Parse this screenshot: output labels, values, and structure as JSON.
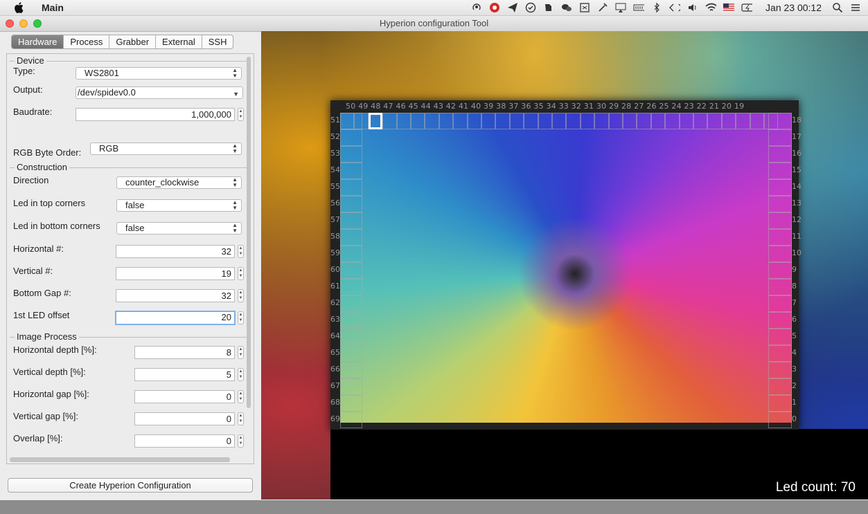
{
  "menubar": {
    "app_name": "Main",
    "clock": "Jan 23  00:12",
    "status_icons": [
      "podcast-icon",
      "red-dot-icon",
      "send-icon",
      "checkmark-icon",
      "evernote-icon",
      "wechat-icon",
      "dropbox-icon",
      "tools-icon",
      "airplay-icon",
      "battery-meter-icon",
      "bluetooth-icon",
      "code-icon",
      "volume-icon",
      "wifi-icon",
      "flag-us-icon",
      "battery-icon",
      "search-icon",
      "menu-icon"
    ]
  },
  "window": {
    "title": "Hyperion configuration Tool"
  },
  "tabs": [
    "Hardware",
    "Process",
    "Grabber",
    "External",
    "SSH"
  ],
  "active_tab": "Hardware",
  "device": {
    "group_label": "Device",
    "type_label": "Type:",
    "type_value": "WS2801",
    "output_label": "Output:",
    "output_value": "/dev/spidev0.0",
    "baudrate_label": "Baudrate:",
    "baudrate_value": "1,000,000",
    "rgb_label": "RGB Byte Order:",
    "rgb_value": "RGB"
  },
  "construction": {
    "group_label": "Construction",
    "direction_label": "Direction",
    "direction_value": "counter_clockwise",
    "top_corners_label": "Led in top corners",
    "top_corners_value": "false",
    "bottom_corners_label": "Led in bottom corners",
    "bottom_corners_value": "false",
    "horizontal_label": "Horizontal #:",
    "horizontal_value": "32",
    "vertical_label": "Vertical #:",
    "vertical_value": "19",
    "bottom_gap_label": "Bottom Gap #:",
    "bottom_gap_value": "32",
    "offset_label": "1st LED offset",
    "offset_value": "20"
  },
  "image_process": {
    "group_label": "Image Process",
    "hdepth_label": "Horizontal depth [%]:",
    "hdepth_value": "8",
    "vdepth_label": "Vertical depth [%]:",
    "vdepth_value": "5",
    "hgap_label": "Horizontal gap [%]:",
    "hgap_value": "0",
    "vgap_label": "Vertical gap [%]:",
    "vgap_value": "0",
    "overlap_label": "Overlap [%]:",
    "overlap_value": "0"
  },
  "create_button": "Create Hyperion Configuration",
  "preview": {
    "top_numbers": "50 49 48 47 46 45 44 43 42 41 40 39 38 37 36 35 34 33 32 31 30 29 28 27 26 25 24 23 22 21 20 19",
    "left_numbers": [
      "51",
      "52",
      "53",
      "54",
      "55",
      "56",
      "57",
      "58",
      "59",
      "60",
      "61",
      "62",
      "63",
      "64",
      "65",
      "66",
      "67",
      "68",
      "69"
    ],
    "right_numbers": [
      "18",
      "17",
      "16",
      "15",
      "14",
      "13",
      "12",
      "11",
      "10",
      "9",
      "8",
      "7",
      "6",
      "5",
      "4",
      "3",
      "2",
      "1",
      "0"
    ],
    "led_count": "Led count: 70"
  }
}
